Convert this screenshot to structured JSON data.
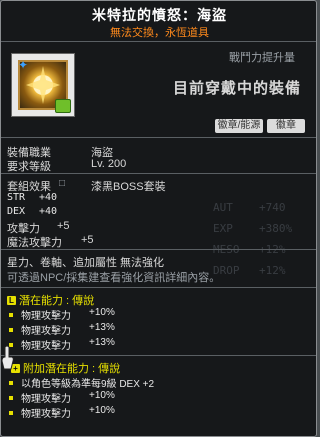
{
  "header": {
    "item_name": "米特拉的憤怒：海盜",
    "restriction": "無法交換，永恆道具"
  },
  "icon": {
    "name": "emblem-icon",
    "lock": "lock-badge-icon",
    "star": "star-icon"
  },
  "attack_label": "戰鬥力提升量",
  "equipped_title": "目前穿戴中的裝備",
  "badges": [
    "徽章/能源",
    "徽章"
  ],
  "info": {
    "job_label": "裝備職業",
    "job_value": "海盜",
    "level_label": "要求等級",
    "level_value": "Lv. 200",
    "set_label": "套組效果",
    "set_value": "漆黑BOSS套裝"
  },
  "stats": [
    {
      "label": "STR",
      "value": "+40"
    },
    {
      "label": "DEX",
      "value": "+40"
    },
    {
      "label": "攻擊力",
      "value": "+5"
    },
    {
      "label": "魔法攻擊力",
      "value": "+5"
    }
  ],
  "notes": {
    "line1": "星力、卷軸、追加屬性 無法強化",
    "line2": "可透過NPC/採集建查看強化資訊詳細內容。"
  },
  "potential": {
    "title": "潛在能力 : 傳說",
    "lines": [
      {
        "label": "物理攻擊力",
        "value": "+10%"
      },
      {
        "label": "物理攻擊力",
        "value": "+13%"
      },
      {
        "label": "物理攻擊力",
        "value": "+13%"
      }
    ]
  },
  "bonus_potential": {
    "title": "附加潛在能力 : 傳說",
    "lines": [
      {
        "label": "以角色等級為準每9級 DEX +2",
        "value": ""
      },
      {
        "label": "物理攻擊力",
        "value": "+10%"
      },
      {
        "label": "物理攻擊力",
        "value": "+10%"
      }
    ]
  },
  "background_ghost": [
    "AUT",
    "EXP",
    "MESO",
    "DROP"
  ],
  "background_ghost_values": [
    "+740",
    "+380%",
    "+12%",
    "+12%"
  ],
  "colors": {
    "accent": "#e6e000",
    "restriction": "#ff8a1c",
    "panel": "#121416"
  }
}
